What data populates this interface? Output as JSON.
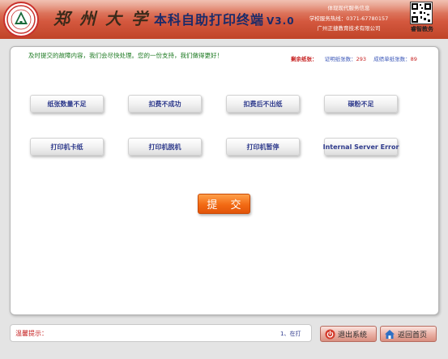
{
  "header": {
    "school_name": "郑州大学",
    "app_title": "本科自助打印终端",
    "version": "V3.0",
    "contact_lines": [
      "体现现代服务信息",
      "学校服务热线：0371-67780157",
      "广州正捷教育技术有限公司"
    ],
    "qr_label": "睿智教务"
  },
  "notice": "及时提交的故障内容，我们会尽快处理。您的一份支持，我们做得更好！",
  "remaining": {
    "label": "剩余纸张：",
    "cert_label": "证明纸张数：",
    "cert_value": "293",
    "score_label": "成绩单纸张数：",
    "score_value": "89"
  },
  "faults": {
    "paper_shortage": "纸张数量不足",
    "charge_failed": "扣费不成功",
    "charged_no_paper": "扣费后不出纸",
    "toner_low": "碳粉不足",
    "paper_jam": "打印机卡纸",
    "printer_offline": "打印机脱机",
    "printer_paused": "打印机暂停",
    "server_error": "Internal Server Error"
  },
  "submit_label": "提 交",
  "footer": {
    "tips_label": "温馨提示：",
    "tips_text": "1、在打",
    "exit_label": "退出系统",
    "home_label": "返回首页"
  },
  "colors": {
    "header_top": "#e9a08a",
    "header_bottom": "#c04428",
    "submit": "#f26a14",
    "button_text": "#2e3a8c"
  }
}
